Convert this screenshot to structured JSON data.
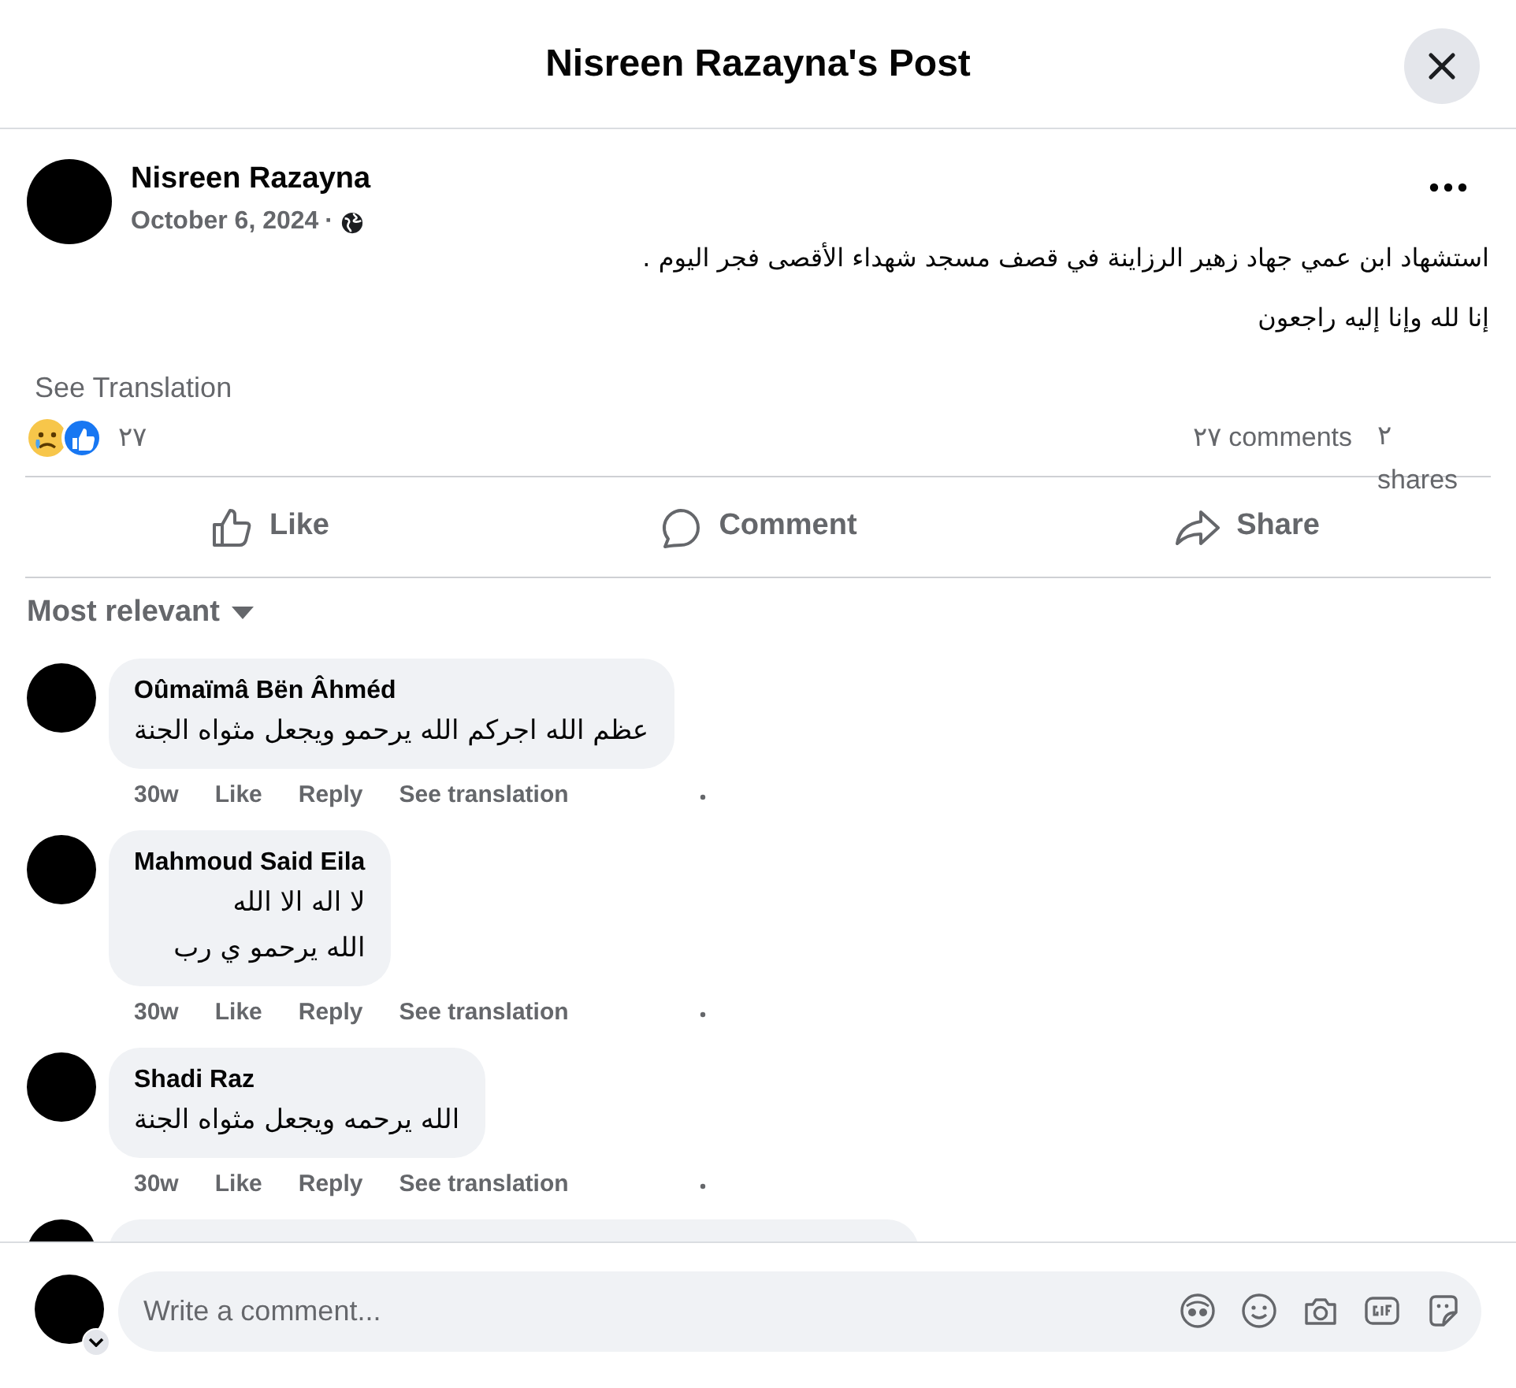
{
  "header": {
    "title": "Nisreen Razayna's Post"
  },
  "post": {
    "author": "Nisreen Razayna",
    "date": "October 6, 2024",
    "separator": "·",
    "text": [
      "استشهاد ابن عمي جهاد زهير الرزاينة  في قصف مسجد شهداء الأقصى فجر اليوم .",
      "إنا لله وإنا إليه راجعون"
    ],
    "see_translation": "See Translation",
    "reactions_count": "٢٧",
    "comments_count": "٢٧ comments",
    "shares_count": "٢ shares",
    "actions": [
      {
        "kind": "like",
        "label": "Like"
      },
      {
        "kind": "comment",
        "label": "Comment"
      },
      {
        "kind": "share",
        "label": "Share"
      }
    ]
  },
  "sort": {
    "label": "Most relevant"
  },
  "comments": [
    {
      "author": "Oûmaïmâ Bën Âhméd",
      "text": [
        "عظم الله اجركم الله يرحمو ويجعل مثواه الجنة"
      ],
      "time": "30w",
      "actions": [
        "Like",
        "Reply",
        "See translation"
      ]
    },
    {
      "author": "Mahmoud Said Eila",
      "text": [
        "لا اله الا الله",
        "الله يرحمو ي رب"
      ],
      "time": "30w",
      "actions": [
        "Like",
        "Reply",
        "See translation"
      ]
    },
    {
      "author": "Shadi Raz",
      "text": [
        "الله يرحمه ويجعل مثواه الجنة"
      ],
      "time": "30w",
      "actions": [
        "Like",
        "Reply",
        "See translation"
      ]
    }
  ],
  "composer": {
    "placeholder": "Write a comment..."
  }
}
